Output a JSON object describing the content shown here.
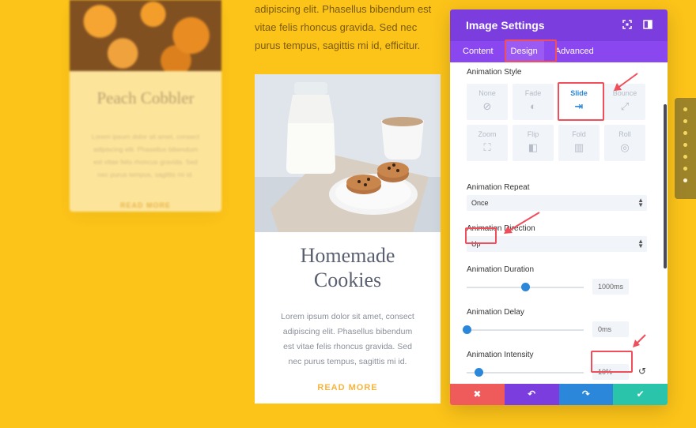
{
  "background": {
    "card": {
      "title": "Peach Cobbler",
      "body": "Lorem ipsum dolor sit amet, consect adipiscing elit. Phasellus bibendum est vitae felis rhoncus gravida. Sed nec purus tempus, sagittis mi id.",
      "read_more": "READ MORE"
    },
    "text": "adipiscing elit. Phasellus bibendum est vitae felis rhoncus gravida. Sed nec purus tempus, sagittis mi id, efficitur."
  },
  "card": {
    "title": "Homemade Cookies",
    "body": "Lorem ipsum dolor sit amet, consect adipiscing elit. Phasellus bibendum est vitae felis rhoncus gravida. Sed nec purus tempus, sagittis mi id.",
    "read_more": "READ MORE"
  },
  "panel": {
    "title": "Image Settings",
    "tabs": [
      "Content",
      "Design",
      "Advanced"
    ],
    "active_tab": "Design",
    "animation_style": {
      "label": "Animation Style",
      "options": [
        {
          "name": "None",
          "icon": "none-icon",
          "glyph": "⊘"
        },
        {
          "name": "Fade",
          "icon": "fade-icon",
          "glyph": "◐"
        },
        {
          "name": "Slide",
          "icon": "slide-icon",
          "glyph": "⇥"
        },
        {
          "name": "Bounce",
          "icon": "bounce-icon",
          "glyph": "⤢"
        },
        {
          "name": "Zoom",
          "icon": "zoom-icon",
          "glyph": "⛶"
        },
        {
          "name": "Flip",
          "icon": "flip-icon",
          "glyph": "◧"
        },
        {
          "name": "Fold",
          "icon": "fold-icon",
          "glyph": "▥"
        },
        {
          "name": "Roll",
          "icon": "roll-icon",
          "glyph": "◎"
        }
      ],
      "selected": "Slide"
    },
    "animation_repeat": {
      "label": "Animation Repeat",
      "value": "Once"
    },
    "animation_direction": {
      "label": "Animation Direction",
      "value": "Up"
    },
    "animation_duration": {
      "label": "Animation Duration",
      "value": "1000ms",
      "level": 0.5
    },
    "animation_delay": {
      "label": "Animation Delay",
      "value": "0ms",
      "level": 0.0
    },
    "animation_intensity": {
      "label": "Animation Intensity",
      "value": "10%",
      "level": 0.1
    }
  },
  "footer": {
    "cancel": "✖",
    "undo": "↶",
    "redo": "↷",
    "save": "✔",
    "colors": {
      "cancel": "#ef5b5b",
      "undo": "#7c3ddf",
      "redo": "#2b87da",
      "save": "#29c4a9"
    }
  },
  "accent": {
    "purple": "#7c3ddf",
    "blue": "#2b87da",
    "highlight": "#f04e5a"
  }
}
